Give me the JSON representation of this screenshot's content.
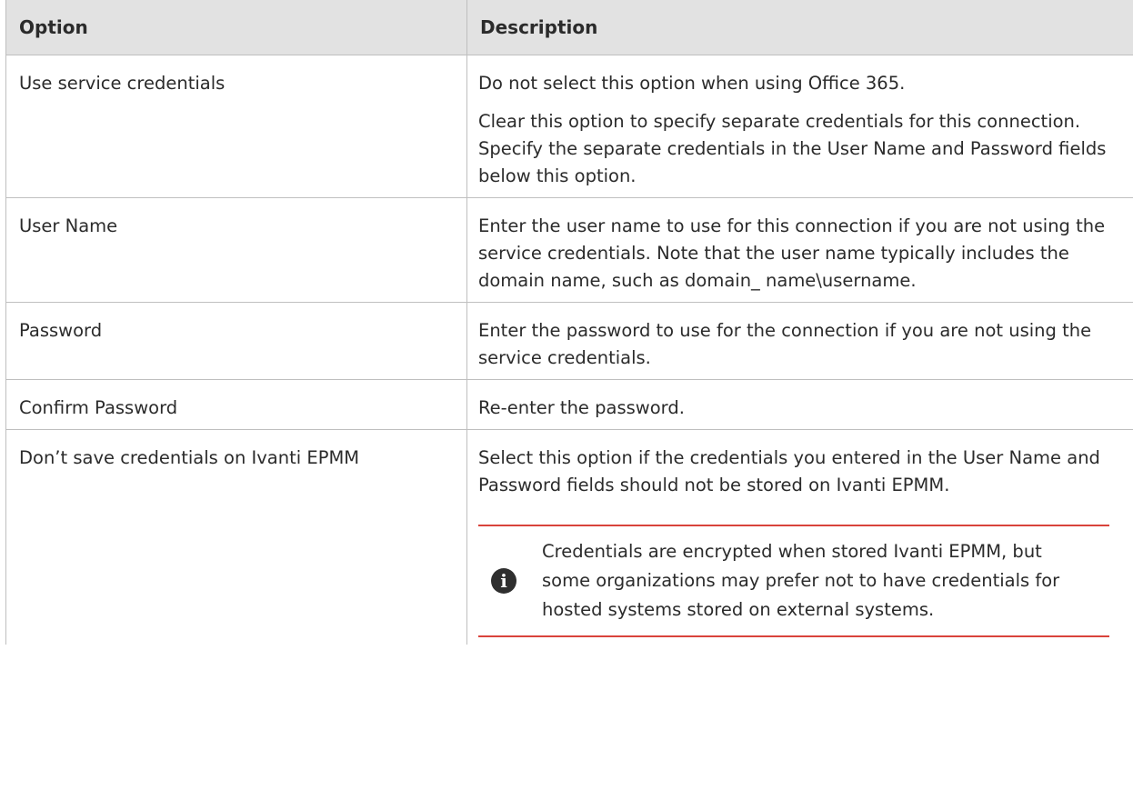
{
  "table": {
    "headers": {
      "option": "Option",
      "description": "Description"
    },
    "rows": [
      {
        "option": "Use service credentials",
        "description": [
          "Do not select this option when using Office 365.",
          "Clear this option to specify separate credentials for this connection. Specify the separate credentials in the User Name and Password fields below this option."
        ]
      },
      {
        "option": "User Name",
        "description": [
          "Enter the user name to use for this connection if you are not using the service credentials. Note that the user name typically includes the domain name, such as domain_ name\\username."
        ]
      },
      {
        "option": "Password",
        "description": [
          "Enter the password to use for the connection if you are not using the service credentials."
        ]
      },
      {
        "option": "Confirm Password",
        "description": [
          "Re-enter the password."
        ]
      },
      {
        "option": "Don’t save credentials on Ivanti EPMM",
        "description": [
          "Select this option if the credentials you entered in the User Name and Password fields should not be stored on Ivanti EPMM."
        ],
        "note": {
          "icon": "info-icon",
          "text": "Credentials are encrypted when stored Ivanti EPMM, but some organizations may prefer not to have credentials for hosted systems stored on external systems."
        }
      }
    ]
  }
}
